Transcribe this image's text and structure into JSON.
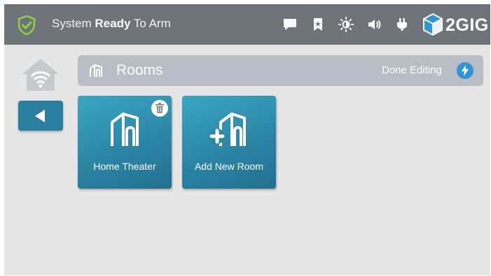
{
  "status_bar": {
    "status_prefix": "System ",
    "status_bold": "Ready",
    "status_suffix": " To Arm",
    "brand": "2GIG",
    "icons": [
      "shield-check-icon",
      "message-icon",
      "bookmark-icon",
      "brightness-icon",
      "volume-icon",
      "plug-icon"
    ]
  },
  "sidebar": {
    "home_icon": "wifi-home-icon",
    "back_icon": "back-arrow-icon"
  },
  "header": {
    "title": "Rooms",
    "title_icon": "room-icon",
    "done_label": "Done Editing",
    "done_icon": "lightning-icon"
  },
  "rooms": [
    {
      "label": "Home Theater",
      "icon": "room-icon",
      "deletable": true
    },
    {
      "label": "Add New Room",
      "icon": "add-room-icon",
      "deletable": false
    }
  ],
  "colors": {
    "status_bar": "#6f747b",
    "background": "#e6e6e7",
    "title_bar": "#b8bec5",
    "tile": "#2b86a6",
    "accent": "#2f96d6"
  }
}
